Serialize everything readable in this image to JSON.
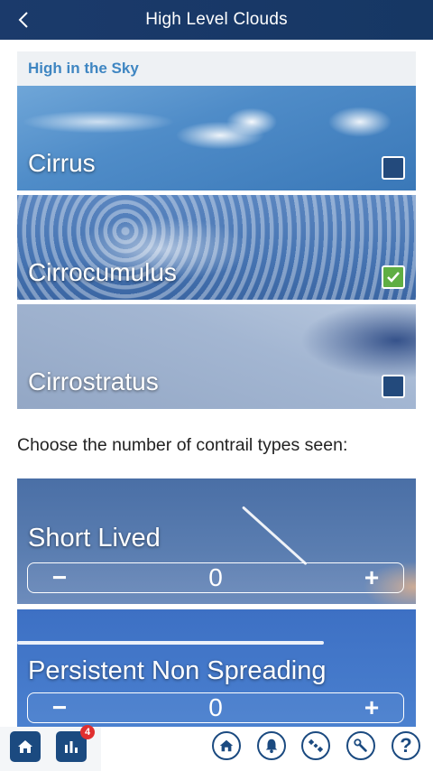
{
  "header": {
    "title": "High Level Clouds",
    "back_icon": "chevron-left-icon"
  },
  "section": {
    "title": "High in the Sky"
  },
  "clouds": [
    {
      "label": "Cirrus",
      "checked": false
    },
    {
      "label": "Cirrocumulus",
      "checked": true
    },
    {
      "label": "Cirrostratus",
      "checked": false
    }
  ],
  "prompt": "Choose the number of contrail types seen:",
  "contrails": [
    {
      "label": "Short Lived",
      "value": "0",
      "minus": "−",
      "plus": "+"
    },
    {
      "label": "Persistent Non Spreading",
      "value": "0",
      "minus": "−",
      "plus": "+"
    }
  ],
  "toolbar": {
    "badge_count": "4",
    "help": "?",
    "icons": [
      "home-icon",
      "stats-icon",
      "home-circle-icon",
      "bell-icon",
      "satellite-icon",
      "wrench-icon",
      "help-icon"
    ]
  },
  "colors": {
    "header_bg": "#1b3a6b",
    "accent": "#3f86c2",
    "checkbox_unchecked": "#234a7c",
    "checkbox_checked": "#5fae43",
    "badge": "#e02f2f"
  }
}
